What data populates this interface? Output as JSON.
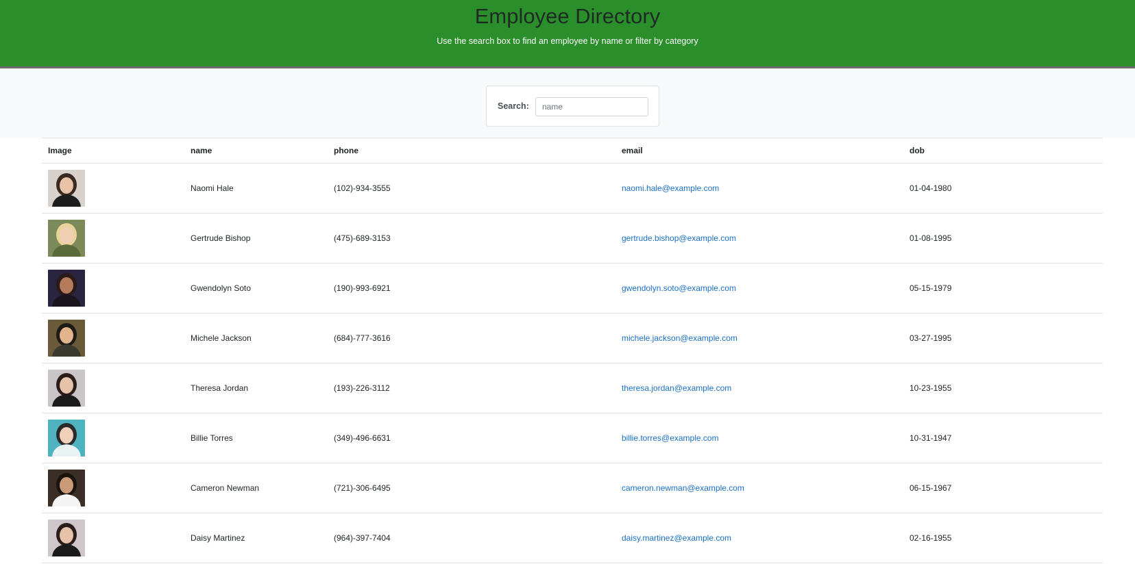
{
  "header": {
    "title": "Employee Directory",
    "subtitle": "Use the search box to find an employee by name or filter by category"
  },
  "search": {
    "label": "Search:",
    "placeholder": "name",
    "value": ""
  },
  "table": {
    "columns": [
      "Image",
      "name",
      "phone",
      "email",
      "dob"
    ],
    "rows": [
      {
        "image": "portrait-photo",
        "name": "Naomi Hale",
        "phone": "(102)-934-3555",
        "email": "naomi.hale@example.com",
        "dob": "01-04-1980"
      },
      {
        "image": "portrait-photo",
        "name": "Gertrude Bishop",
        "phone": "(475)-689-3153",
        "email": "gertrude.bishop@example.com",
        "dob": "01-08-1995"
      },
      {
        "image": "portrait-photo",
        "name": "Gwendolyn Soto",
        "phone": "(190)-993-6921",
        "email": "gwendolyn.soto@example.com",
        "dob": "05-15-1979"
      },
      {
        "image": "portrait-photo",
        "name": "Michele Jackson",
        "phone": "(684)-777-3616",
        "email": "michele.jackson@example.com",
        "dob": "03-27-1995"
      },
      {
        "image": "portrait-photo",
        "name": "Theresa Jordan",
        "phone": "(193)-226-3112",
        "email": "theresa.jordan@example.com",
        "dob": "10-23-1955"
      },
      {
        "image": "portrait-photo",
        "name": "Billie Torres",
        "phone": "(349)-496-6631",
        "email": "billie.torres@example.com",
        "dob": "10-31-1947"
      },
      {
        "image": "portrait-photo",
        "name": "Cameron Newman",
        "phone": "(721)-306-6495",
        "email": "cameron.newman@example.com",
        "dob": "06-15-1967"
      },
      {
        "image": "portrait-photo",
        "name": "Daisy Martinez",
        "phone": "(964)-397-7404",
        "email": "daisy.martinez@example.com",
        "dob": "02-16-1955"
      }
    ]
  },
  "colors": {
    "header_bg": "#2a8f2a",
    "link": "#1a6fc2"
  }
}
